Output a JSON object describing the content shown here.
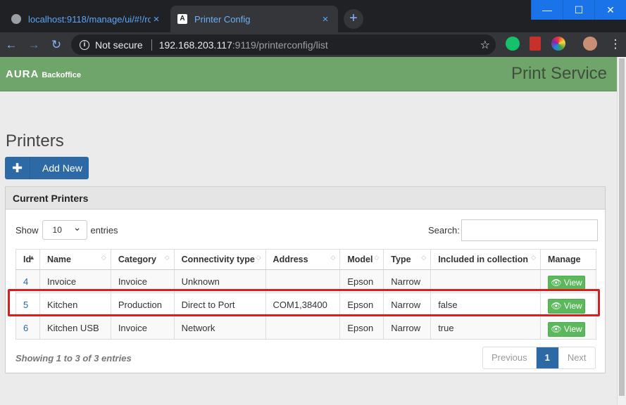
{
  "browser": {
    "tabs": [
      {
        "title": "localhost:9118/manage/ui/#!/roo",
        "close": "×"
      },
      {
        "title": "Printer Config",
        "close": "×"
      }
    ],
    "new_tab": "+",
    "window_controls": {
      "minimize": "—",
      "maximize": "☐",
      "close": "✕"
    },
    "security_label": "Not secure",
    "url_host": "192.168.203.117",
    "url_rest": ":9119/printerconfig/list"
  },
  "app": {
    "logo": "AURA",
    "logo_sub": "Backoffice",
    "service_title": "Print Service",
    "page_title": "Printers",
    "add_button": "Add New",
    "panel_title": "Current Printers",
    "show_label": "Show",
    "entries_label": "entries",
    "page_length": "10",
    "search_label": "Search:",
    "columns": [
      "Id",
      "Name",
      "Category",
      "Connectivity type",
      "Address",
      "Model",
      "Type",
      "Included in collection",
      "Manage"
    ],
    "rows": [
      {
        "id": "4",
        "name": "Invoice",
        "category": "Invoice",
        "connectivity": "Unknown",
        "address": "",
        "model": "Epson",
        "type": "Narrow",
        "included": "",
        "action": "View"
      },
      {
        "id": "5",
        "name": "Kitchen",
        "category": "Production",
        "connectivity": "Direct to Port",
        "address": "COM1,38400",
        "model": "Epson",
        "type": "Narrow",
        "included": "false",
        "action": "View"
      },
      {
        "id": "6",
        "name": "Kitchen USB",
        "category": "Invoice",
        "connectivity": "Network",
        "address": "",
        "model": "Epson",
        "type": "Narrow",
        "included": "true",
        "action": "View"
      }
    ],
    "info": "Showing 1 to 3 of 3 entries",
    "pagination": {
      "previous": "Previous",
      "current": "1",
      "next": "Next"
    }
  },
  "colors": {
    "header_green": "#6fa56a",
    "primary_blue": "#2d6aa5",
    "view_green": "#5cb85c",
    "highlight_red": "#e01b1b"
  }
}
